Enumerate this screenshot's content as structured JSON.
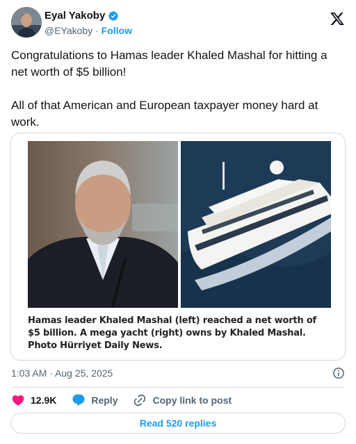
{
  "author": {
    "display_name": "Eyal Yakoby",
    "handle": "@EYakoby",
    "separator": " · ",
    "follow_label": "Follow",
    "verified_color": "#1d9bf0"
  },
  "tweet": {
    "paragraphs": [
      "Congratulations to Hamas leader Khaled Mashal for hitting a net worth of $5 billion!",
      "All of that American and European taxpayer money hard at work."
    ]
  },
  "media": {
    "caption": "Hamas leader Khaled Mashal (left) reached a net worth of $5 billion. A mega yacht (right) owns by Khaled Mashal. Photo Hürriyet Daily News."
  },
  "meta": {
    "timestamp": "1:03 AM · Aug 25, 2025"
  },
  "actions": {
    "like_count": "12.9K",
    "reply_label": "Reply",
    "copy_label": "Copy link to post"
  },
  "footer": {
    "read_replies": "Read 520 replies"
  },
  "colors": {
    "accent": "#1d9bf0",
    "like": "#f91880",
    "text": "#0f1419",
    "muted": "#536471",
    "border": "#cfd9de"
  },
  "icons": {
    "verified": "verified-badge-icon",
    "brand": "x-logo-icon",
    "info": "info-icon",
    "like": "heart-icon",
    "reply": "speech-bubble-icon",
    "copy": "link-icon"
  }
}
